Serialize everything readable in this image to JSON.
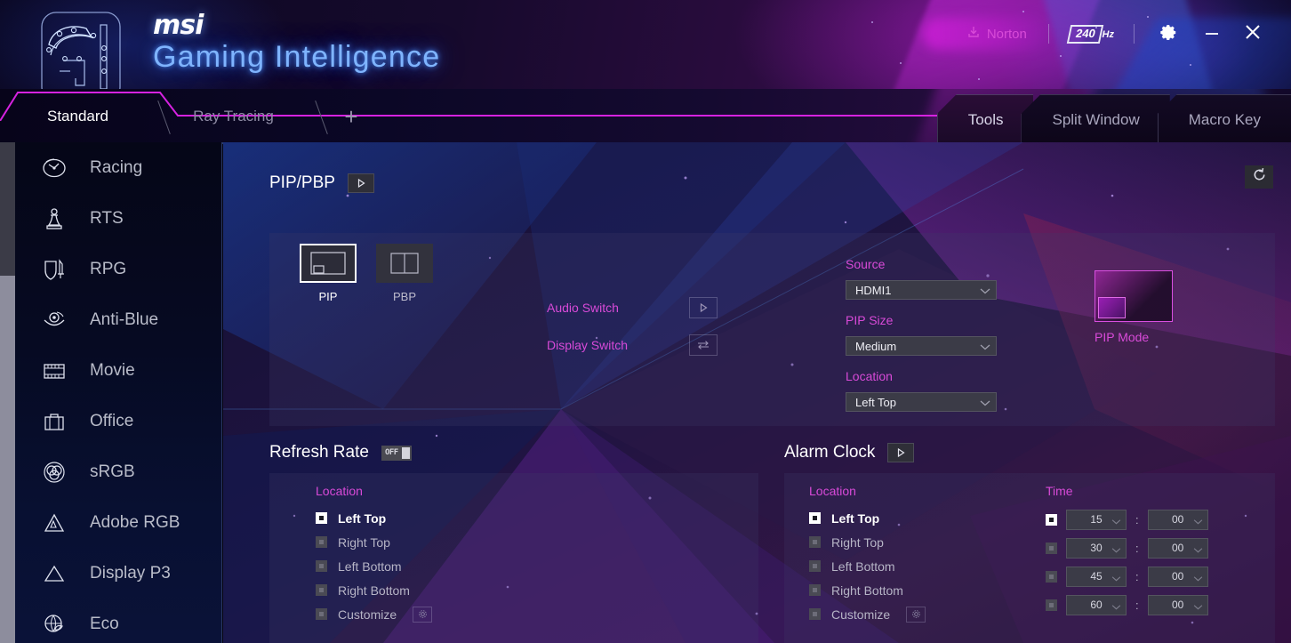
{
  "header": {
    "brand_small": "msi",
    "brand_title": "Gaming Intelligence",
    "norton_label": "Norton",
    "norton_icon": "download-icon",
    "refresh_value": "240",
    "refresh_unit": "Hz",
    "gear_icon": "gear-icon",
    "minimize_icon": "minimize-icon",
    "close_icon": "close-icon",
    "logo_icon": "msi-gi-logo-icon"
  },
  "tabs": {
    "left": [
      {
        "label": "Standard",
        "active": true
      },
      {
        "label": "Ray Tracing",
        "active": false
      }
    ],
    "add_label": "+",
    "right": [
      {
        "label": "Tools",
        "active": true
      },
      {
        "label": "Split Window",
        "active": false
      },
      {
        "label": "Macro Key",
        "active": false
      }
    ]
  },
  "sidebar": {
    "items": [
      {
        "label": "Racing",
        "icon": "speedometer-icon"
      },
      {
        "label": "RTS",
        "icon": "chess-pawn-icon"
      },
      {
        "label": "RPG",
        "icon": "shield-sword-icon"
      },
      {
        "label": "Anti-Blue",
        "icon": "eye-care-icon"
      },
      {
        "label": "Movie",
        "icon": "film-strip-icon"
      },
      {
        "label": "Office",
        "icon": "briefcase-icon"
      },
      {
        "label": "sRGB",
        "icon": "color-circles-icon"
      },
      {
        "label": "Adobe RGB",
        "icon": "adobe-a-icon"
      },
      {
        "label": "Display P3",
        "icon": "triangle-icon"
      },
      {
        "label": "Eco",
        "icon": "globe-leaf-icon"
      }
    ]
  },
  "content": {
    "reset_icon": "reset-icon",
    "pip_pbp": {
      "title": "PIP/PBP",
      "toggle_icon": "play-icon",
      "modes": [
        {
          "label": "PIP",
          "active": true,
          "icon": "pip-layout-icon"
        },
        {
          "label": "PBP",
          "active": false,
          "icon": "pbp-layout-icon"
        }
      ],
      "audio_switch_label": "Audio Switch",
      "audio_switch_icon": "play-icon",
      "display_switch_label": "Display Switch",
      "display_switch_icon": "swap-arrows-icon",
      "source_label": "Source",
      "source_value": "HDMI1",
      "pip_size_label": "PIP Size",
      "pip_size_value": "Medium",
      "location_label": "Location",
      "location_value": "Left Top",
      "preview_caption": "PIP Mode"
    },
    "refresh_rate": {
      "title": "Refresh Rate",
      "toggle_state": "OFF",
      "location_label": "Location",
      "options": [
        {
          "label": "Left Top",
          "selected": true
        },
        {
          "label": "Right Top",
          "selected": false
        },
        {
          "label": "Left Bottom",
          "selected": false
        },
        {
          "label": "Right Bottom",
          "selected": false
        },
        {
          "label": "Customize",
          "selected": false,
          "gear_icon": "gear-icon"
        }
      ]
    },
    "alarm_clock": {
      "title": "Alarm Clock",
      "toggle_icon": "play-icon",
      "location_label": "Location",
      "options": [
        {
          "label": "Left Top",
          "selected": true
        },
        {
          "label": "Right Top",
          "selected": false
        },
        {
          "label": "Left Bottom",
          "selected": false
        },
        {
          "label": "Right Bottom",
          "selected": false
        },
        {
          "label": "Customize",
          "selected": false,
          "gear_icon": "gear-icon"
        }
      ],
      "time_label": "Time",
      "times": [
        {
          "minutes": "15",
          "seconds": "00",
          "selected": true
        },
        {
          "minutes": "30",
          "seconds": "00",
          "selected": false
        },
        {
          "minutes": "45",
          "seconds": "00",
          "selected": false
        },
        {
          "minutes": "60",
          "seconds": "00",
          "selected": false
        }
      ],
      "separator": ":"
    }
  },
  "colors": {
    "accent_magenta": "#d84ad8",
    "brand_blue": "#7fb4ff",
    "panel": "#3e3a6a"
  }
}
